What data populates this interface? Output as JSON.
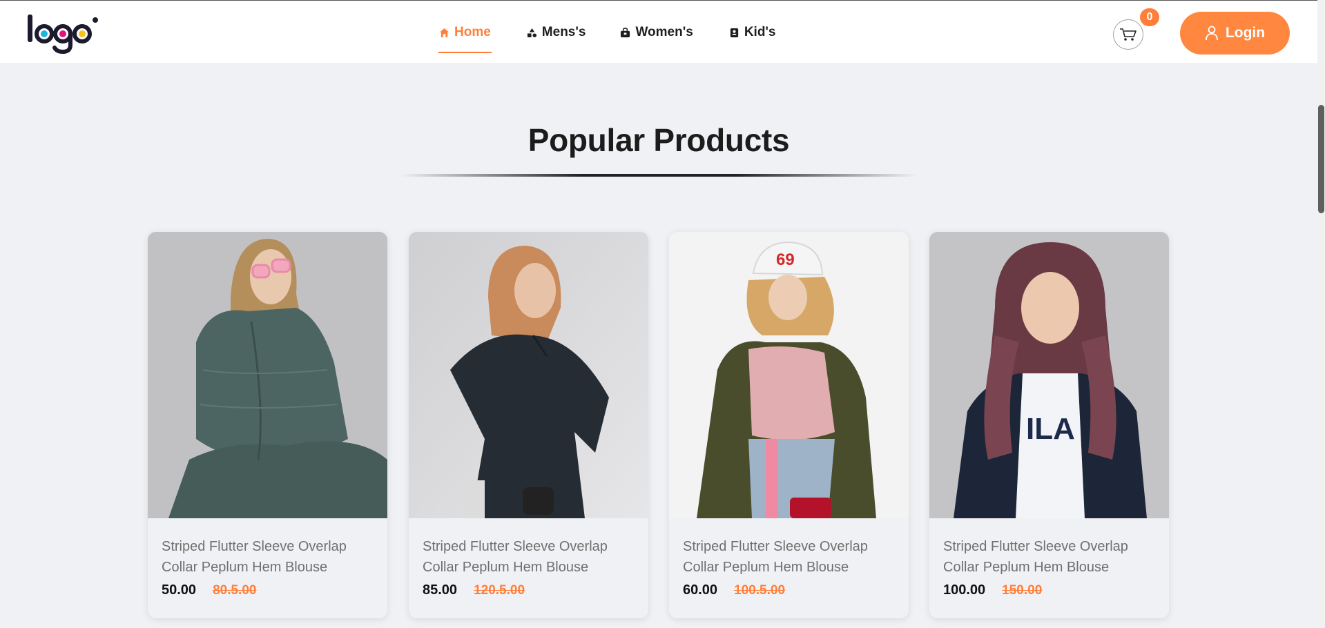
{
  "header": {
    "logo_alt": "logo",
    "nav": [
      {
        "label": "Home",
        "icon": "home-icon",
        "active": true
      },
      {
        "label": "Mens's",
        "icon": "shapes-icon",
        "active": false
      },
      {
        "label": "Women's",
        "icon": "shopping-bag-icon",
        "active": false
      },
      {
        "label": "Kid's",
        "icon": "contact-card-icon",
        "active": false
      }
    ],
    "cart_count": "0",
    "login_label": "Login"
  },
  "section": {
    "title": "Popular Products"
  },
  "products": [
    {
      "title": "Striped Flutter Sleeve Overlap Collar Peplum Hem Blouse",
      "price": "50.00",
      "old_price": "80.5.00"
    },
    {
      "title": "Striped Flutter Sleeve Overlap Collar Peplum Hem Blouse",
      "price": "85.00",
      "old_price": "120.5.00"
    },
    {
      "title": "Striped Flutter Sleeve Overlap Collar Peplum Hem Blouse",
      "price": "60.00",
      "old_price": "100.5.00"
    },
    {
      "title": "Striped Flutter Sleeve Overlap Collar Peplum Hem Blouse",
      "price": "100.00",
      "old_price": "150.00"
    }
  ],
  "colors": {
    "accent": "#ff7f3a",
    "page_bg": "#eff1f5"
  }
}
